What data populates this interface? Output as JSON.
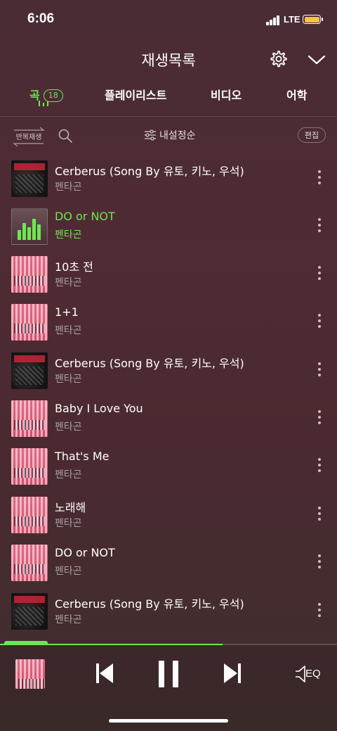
{
  "status": {
    "time": "6:06",
    "network": "LTE"
  },
  "header": {
    "title": "재생목록",
    "settings_icon": "gear-icon",
    "collapse_icon": "chevron-down-icon"
  },
  "tabs": [
    {
      "label": "곡",
      "count": "18",
      "active": true
    },
    {
      "label": "플레이리스트"
    },
    {
      "label": "비디오"
    },
    {
      "label": "어학"
    }
  ],
  "toolbar": {
    "repeat_label": "반복재생",
    "sort_label": "내설정순",
    "edit_label": "편집"
  },
  "tracks": [
    {
      "title": "Cerberus (Song By 유토, 키노, 우석)",
      "artist": "펜타곤",
      "art": "black"
    },
    {
      "title": "DO or NOT",
      "artist": "펜타곤",
      "art": "playing",
      "playing": true
    },
    {
      "title": "10초 전",
      "artist": "펜타곤",
      "art": "red"
    },
    {
      "title": "1+1",
      "artist": "펜타곤",
      "art": "red"
    },
    {
      "title": "Cerberus (Song By 유토, 키노, 우석)",
      "artist": "펜타곤",
      "art": "black"
    },
    {
      "title": "Baby I Love You",
      "artist": "펜타곤",
      "art": "red"
    },
    {
      "title": "That's Me",
      "artist": "펜타곤",
      "art": "red"
    },
    {
      "title": "노래해",
      "artist": "펜타곤",
      "art": "red"
    },
    {
      "title": "DO or NOT",
      "artist": "펜타곤",
      "art": "red"
    },
    {
      "title": "Cerberus (Song By 유토, 키노, 우석)",
      "artist": "펜타곤",
      "art": "black"
    }
  ],
  "player": {
    "progress": 0.66,
    "eq_label": "EQ"
  },
  "colors": {
    "accent": "#6de651",
    "background": "#4a2c35"
  }
}
